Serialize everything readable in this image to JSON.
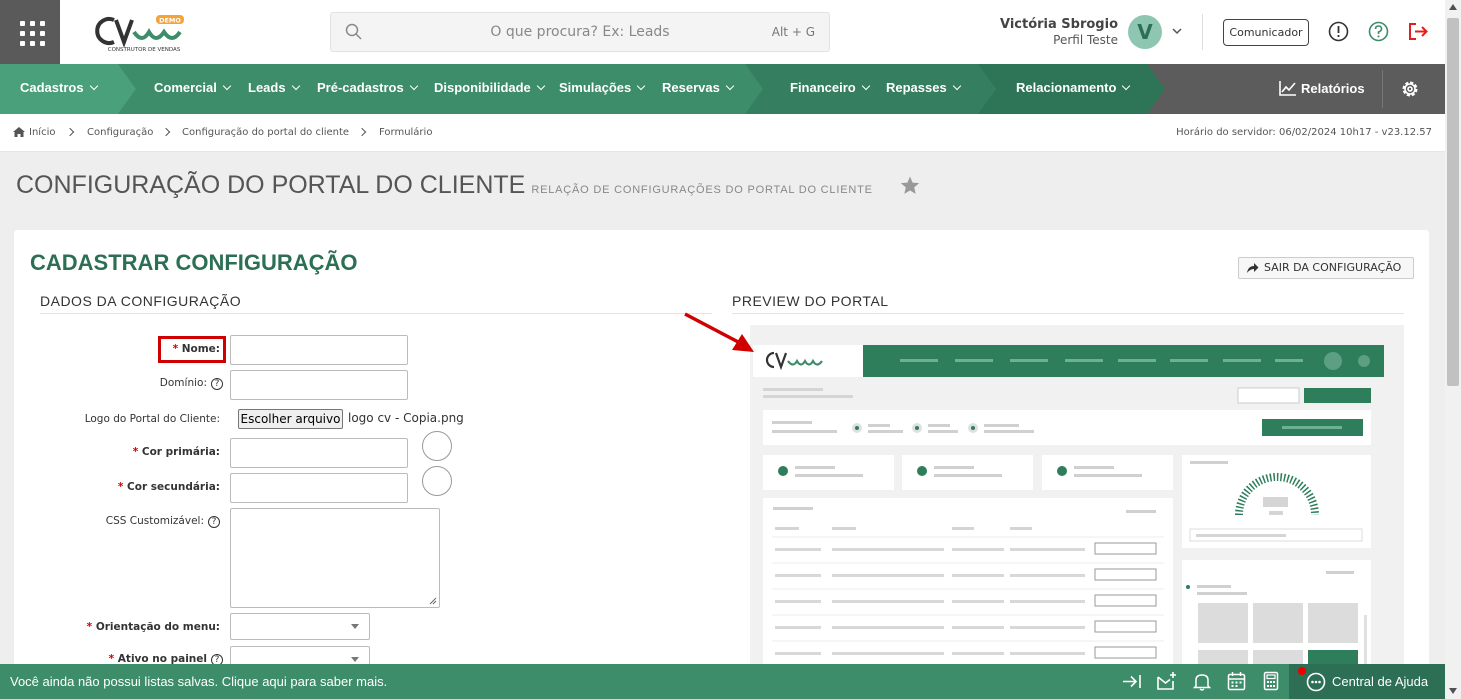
{
  "header": {
    "search_placeholder": "O que procura? Ex: Leads",
    "search_shortcut": "Alt + G",
    "user_name": "Victória Sbrogio",
    "user_profile": "Perfil Teste",
    "avatar_letter": "V",
    "communicator_label": "Comunicador",
    "logo_badge": "DEMO",
    "logo_sub": "CONSTRUTOR DE VENDAS"
  },
  "nav": {
    "items": [
      "Cadastros",
      "Comercial",
      "Leads",
      "Pré-cadastros",
      "Disponibilidade",
      "Simulações",
      "Reservas",
      "Financeiro",
      "Repasses",
      "Relacionamento"
    ],
    "reports_label": "Relatórios"
  },
  "breadcrumb": {
    "items": [
      "Início",
      "Configuração",
      "Configuração do portal do cliente",
      "Formulário"
    ],
    "server_time": "Horário do servidor: 06/02/2024 10h17 - v23.12.57"
  },
  "page": {
    "title": "CONFIGURAÇÃO DO PORTAL DO CLIENTE",
    "subtitle": "RELAÇÃO DE CONFIGURAÇÕES DO PORTAL DO CLIENTE"
  },
  "card": {
    "title": "CADASTRAR CONFIGURAÇÃO",
    "exit_label": "SAIR DA CONFIGURAÇÃO",
    "section_data": "DADOS DA CONFIGURAÇÃO",
    "section_preview": "PREVIEW DO PORTAL"
  },
  "form": {
    "nome_label": "Nome:",
    "dominio_label": "Domínio:",
    "logo_label": "Logo do Portal do Cliente:",
    "file_button": "Escolher arquivo",
    "file_name": "logo cv - Copia.png",
    "cor_primaria_label": "Cor primária:",
    "cor_secundaria_label": "Cor secundária:",
    "css_label": "CSS Customizável:",
    "orientacao_label": "Orientação do menu:",
    "ativo_label": "Ativo no painel",
    "required_mark": "*",
    "help_glyph": "?"
  },
  "bottom": {
    "message": "Você ainda não possui listas salvas. Clique aqui para saber mais.",
    "help_center": "Central de Ajuda"
  },
  "colors": {
    "brand_green": "#3d8c6a",
    "brand_dark": "#2d6f55",
    "highlight_red": "#d00000"
  }
}
